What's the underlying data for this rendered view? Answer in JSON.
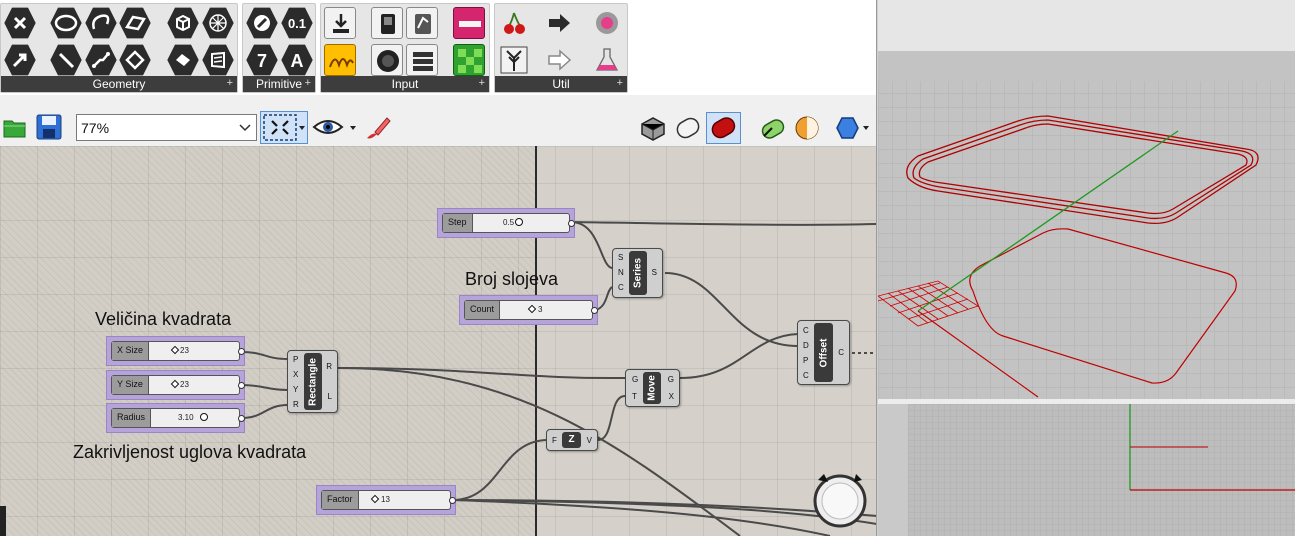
{
  "ribbon": {
    "panels": [
      {
        "id": "geometry",
        "label": "Geometry"
      },
      {
        "id": "primitive",
        "label": "Primitive"
      },
      {
        "id": "input",
        "label": "Input"
      },
      {
        "id": "util",
        "label": "Util"
      }
    ]
  },
  "toolbar": {
    "zoom_value": "77%"
  },
  "canvas": {
    "notes": {
      "size": "Veličina kvadrata",
      "layers": "Broj slojeva",
      "radius": "Zakrivljenost uglova kvadrata"
    },
    "sliders": {
      "step": {
        "name": "Step",
        "value": "0.5"
      },
      "count": {
        "name": "Count",
        "value": "3"
      },
      "xsize": {
        "name": "X Size",
        "value": "23"
      },
      "ysize": {
        "name": "Y Size",
        "value": "23"
      },
      "radius": {
        "name": "Radius",
        "value": "3.10"
      },
      "factor": {
        "name": "Factor",
        "value": "13"
      }
    },
    "components": {
      "rectangle": {
        "label": "Rectangle",
        "inputs": [
          "P",
          "X",
          "Y",
          "R"
        ],
        "outputs": [
          "R",
          "L"
        ]
      },
      "series": {
        "label": "Series",
        "inputs": [
          "S",
          "N",
          "C"
        ],
        "outputs": [
          "S"
        ]
      },
      "move": {
        "label": "Move",
        "inputs": [
          "G",
          "T"
        ],
        "outputs": [
          "G",
          "X"
        ]
      },
      "offset": {
        "label": "Offset",
        "inputs": [
          "C",
          "D",
          "P",
          "C"
        ],
        "outputs": [
          "C"
        ]
      },
      "unitz": {
        "label": "Z",
        "inputs": [
          "F"
        ],
        "outputs": [
          "V"
        ]
      }
    }
  },
  "colors": {
    "slider_bg": "#b6a3d9",
    "curve_red": "#c00000",
    "axis_green": "#1f9a1f"
  }
}
